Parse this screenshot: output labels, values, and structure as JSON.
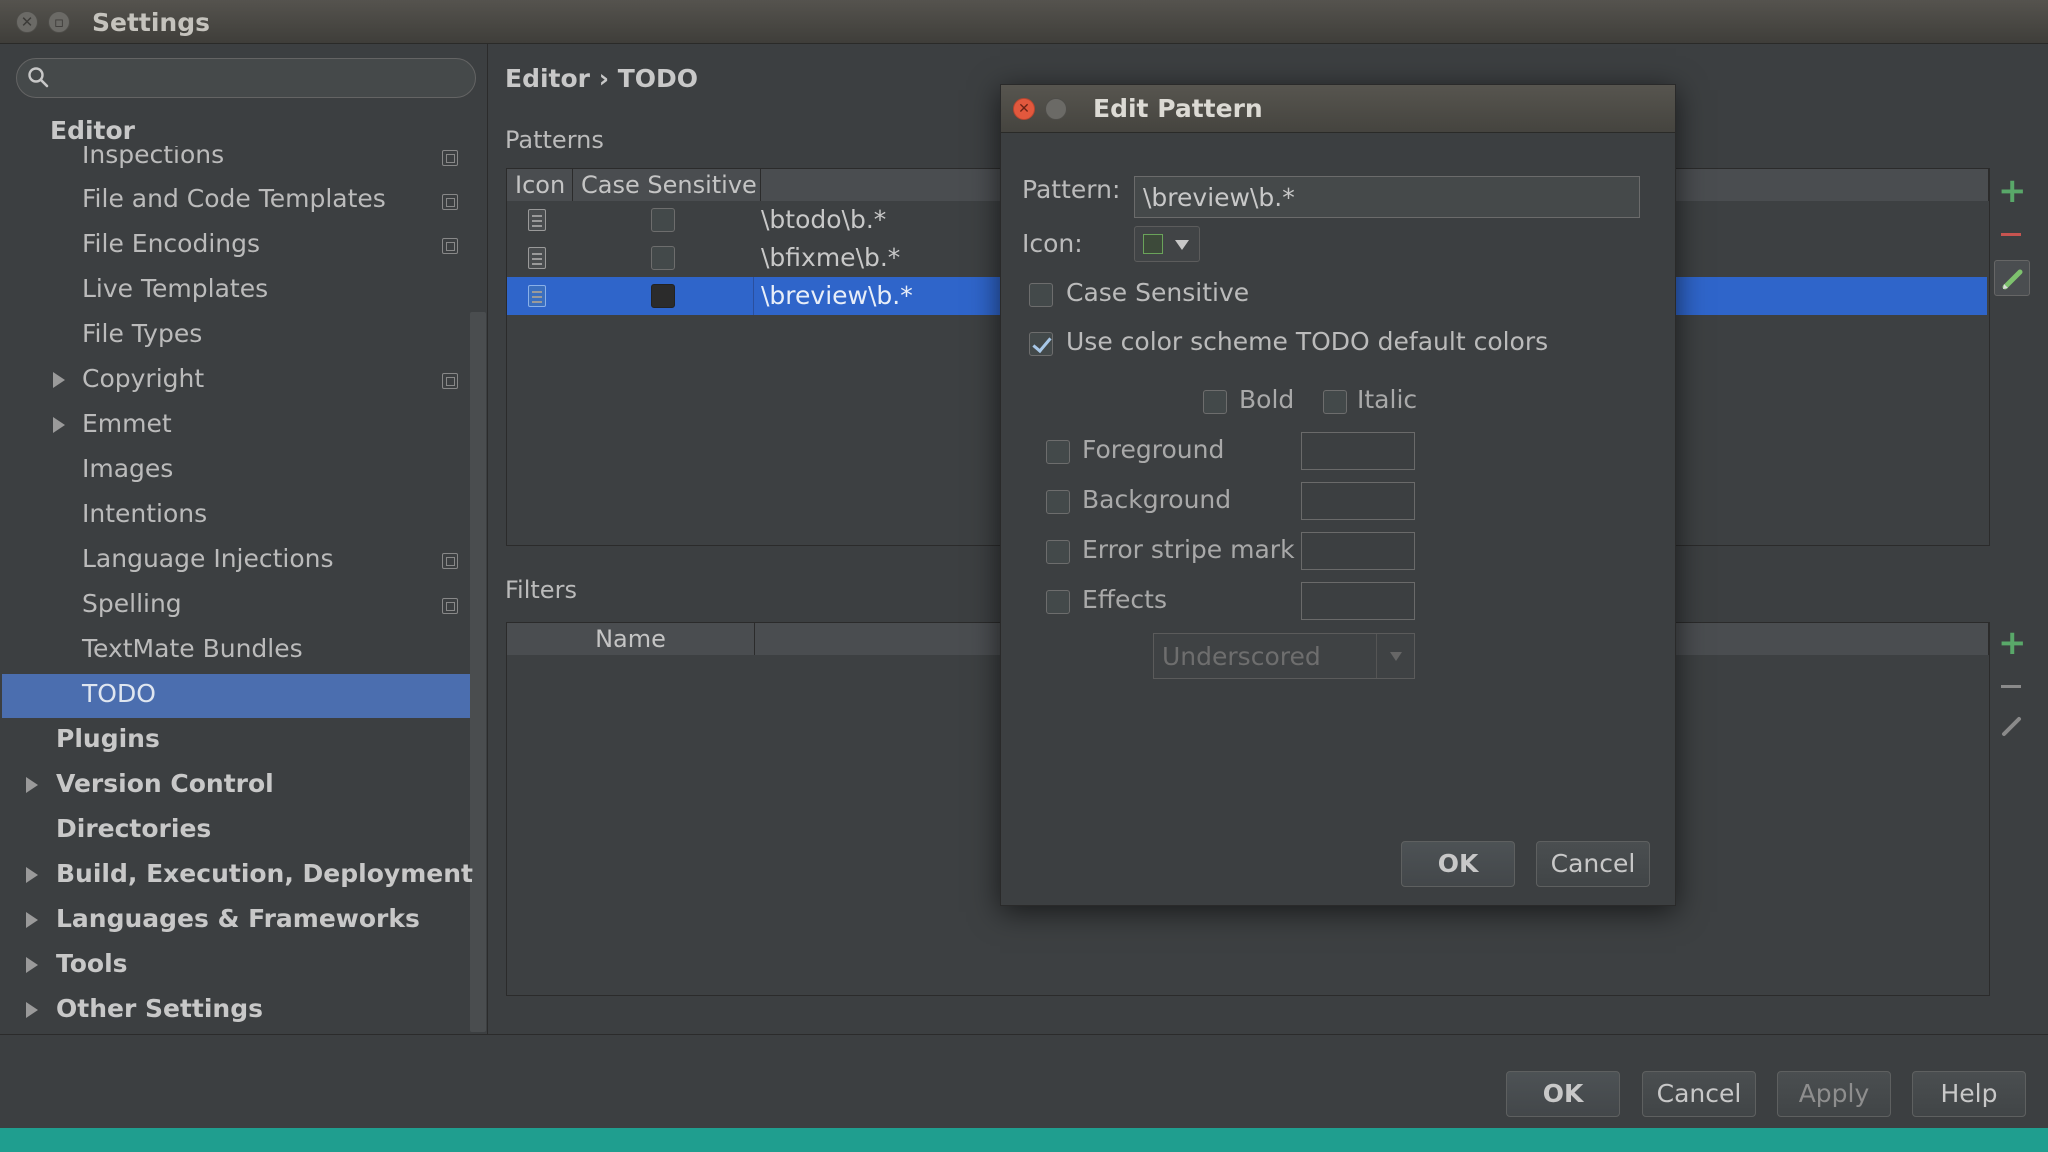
{
  "window": {
    "title": "Settings"
  },
  "sidebar": {
    "search_placeholder": "",
    "items": [
      {
        "label": "Editor",
        "level": 0,
        "bold": true
      },
      {
        "label": "Inspections",
        "level": 1
      },
      {
        "label": "File and Code Templates",
        "level": 1
      },
      {
        "label": "File Encodings",
        "level": 1
      },
      {
        "label": "Live Templates",
        "level": 1
      },
      {
        "label": "File Types",
        "level": 1
      },
      {
        "label": "Copyright",
        "level": 1
      },
      {
        "label": "Emmet",
        "level": 1
      },
      {
        "label": "Images",
        "level": 1
      },
      {
        "label": "Intentions",
        "level": 1
      },
      {
        "label": "Language Injections",
        "level": 1
      },
      {
        "label": "Spelling",
        "level": 1
      },
      {
        "label": "TextMate Bundles",
        "level": 1
      },
      {
        "label": "TODO",
        "level": 1,
        "selected": true
      },
      {
        "label": "Plugins",
        "level": 0,
        "bold": true
      },
      {
        "label": "Version Control",
        "level": 0,
        "bold": true
      },
      {
        "label": "Directories",
        "level": 0,
        "bold": true
      },
      {
        "label": "Build, Execution, Deployment",
        "level": 0,
        "bold": true
      },
      {
        "label": "Languages & Frameworks",
        "level": 0,
        "bold": true
      },
      {
        "label": "Tools",
        "level": 0,
        "bold": true
      },
      {
        "label": "Other Settings",
        "level": 0,
        "bold": true
      }
    ]
  },
  "main": {
    "breadcrumb": "Editor › TODO",
    "patterns_label": "Patterns",
    "patterns_columns": [
      "Icon",
      "Case Sensitive"
    ],
    "patterns_rows": [
      {
        "pattern": "\\btodo\\b.*",
        "case_sensitive": false
      },
      {
        "pattern": "\\bfixme\\b.*",
        "case_sensitive": false
      },
      {
        "pattern": "\\breview\\b.*",
        "case_sensitive": false,
        "selected": true
      }
    ],
    "filters_label": "Filters",
    "filters_columns": [
      "Name"
    ]
  },
  "toolbar_icons": {
    "add": "plus-icon",
    "remove": "minus-icon",
    "edit": "pencil-icon",
    "add_color": "#59a869",
    "remove_color": "#c75450"
  },
  "dialog": {
    "title": "Edit Pattern",
    "pattern_label": "Pattern:",
    "pattern_value": "\\breview\\b.*",
    "icon_label": "Icon:",
    "case_sensitive_label": "Case Sensitive",
    "case_sensitive_checked": false,
    "use_color_scheme_label": "Use color scheme TODO default colors",
    "use_color_scheme_checked": true,
    "bold_label": "Bold",
    "italic_label": "Italic",
    "foreground_label": "Foreground",
    "background_label": "Background",
    "error_stripe_label": "Error stripe mark",
    "effects_label": "Effects",
    "effects_value": "Underscored",
    "ok_label": "OK",
    "cancel_label": "Cancel"
  },
  "footer": {
    "ok_label": "OK",
    "cancel_label": "Cancel",
    "apply_label": "Apply",
    "help_label": "Help"
  },
  "colors": {
    "selection": "#2f65ca",
    "tree_selection": "#4b6eaf",
    "close_button": "#e2583d",
    "status_bar": "#1f9e8f"
  }
}
